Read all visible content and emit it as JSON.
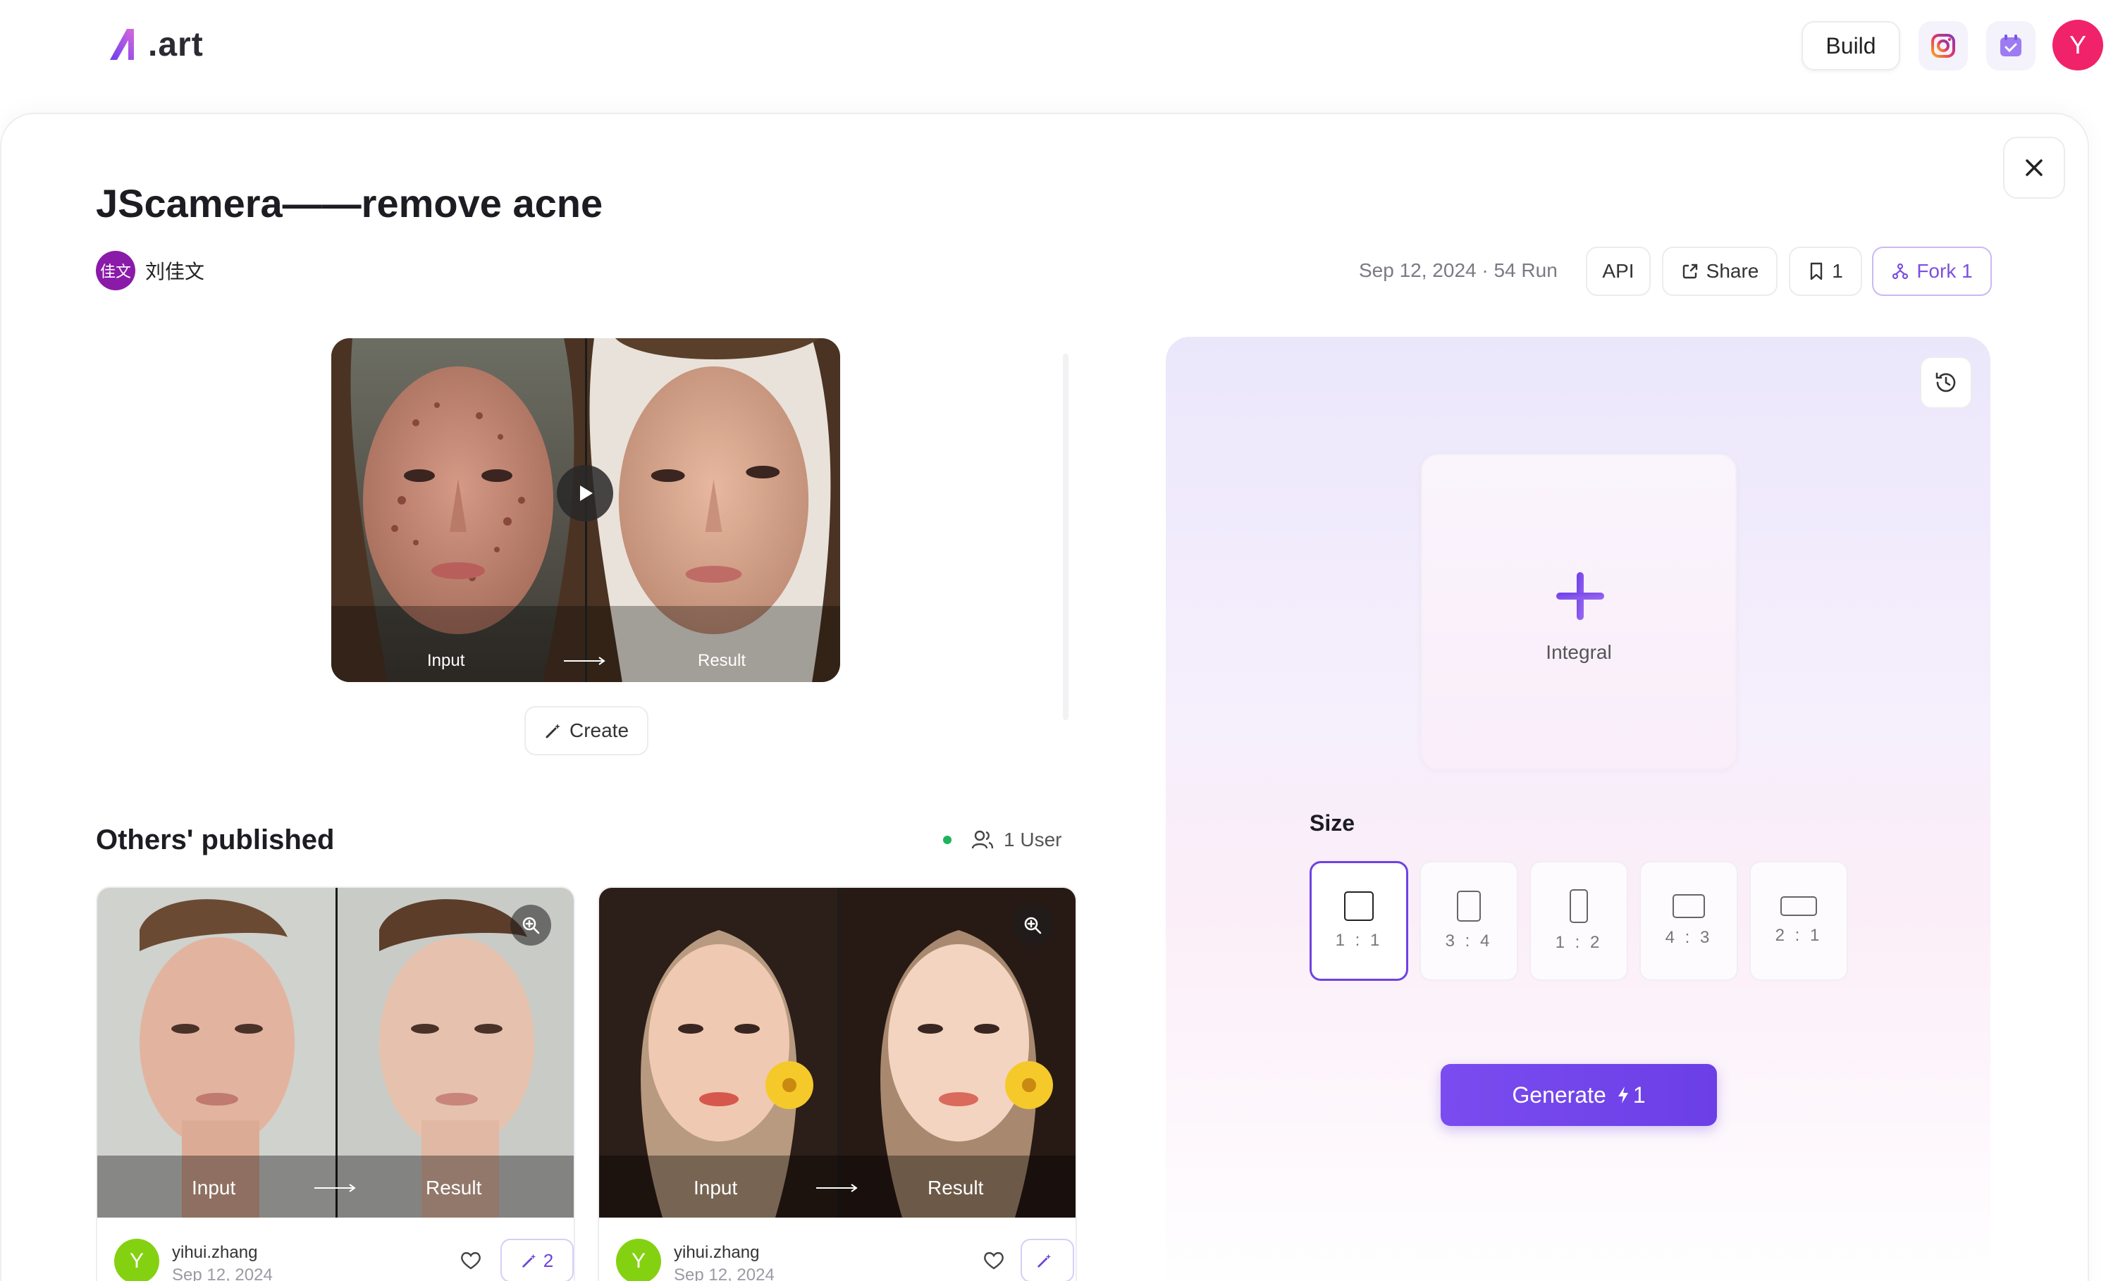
{
  "header": {
    "logo_text": ".art",
    "build_label": "Build",
    "avatar_letter": "Y",
    "brand_color": "#7b4fe0"
  },
  "app": {
    "title": "JScamera——remove acne",
    "author_avatar": "佳文",
    "author_name": "刘佳文",
    "meta": "Sep 12, 2024 · 54 Run",
    "actions": {
      "api": "API",
      "share": "Share",
      "bookmark_count": "1",
      "fork": "Fork 1"
    }
  },
  "preview": {
    "input_label": "Input",
    "result_label": "Result",
    "create_label": "Create"
  },
  "published": {
    "title": "Others' published",
    "users": "1 User",
    "cards": [
      {
        "input_label": "Input",
        "result_label": "Result",
        "avatar": "Y",
        "user": "yihui.zhang",
        "date": "Sep 12, 2024",
        "count": "2"
      },
      {
        "input_label": "Input",
        "result_label": "Result",
        "avatar": "Y",
        "user": "yihui.zhang",
        "date": "Sep 12, 2024",
        "count": ""
      }
    ]
  },
  "panel": {
    "upload_label": "Integral",
    "size_label": "Size",
    "ratios": [
      "1 : 1",
      "3 : 4",
      "1 : 2",
      "4 : 3",
      "2 : 1"
    ],
    "selected_ratio": "1 : 1",
    "generate_label": "Generate",
    "generate_cost": "1"
  }
}
